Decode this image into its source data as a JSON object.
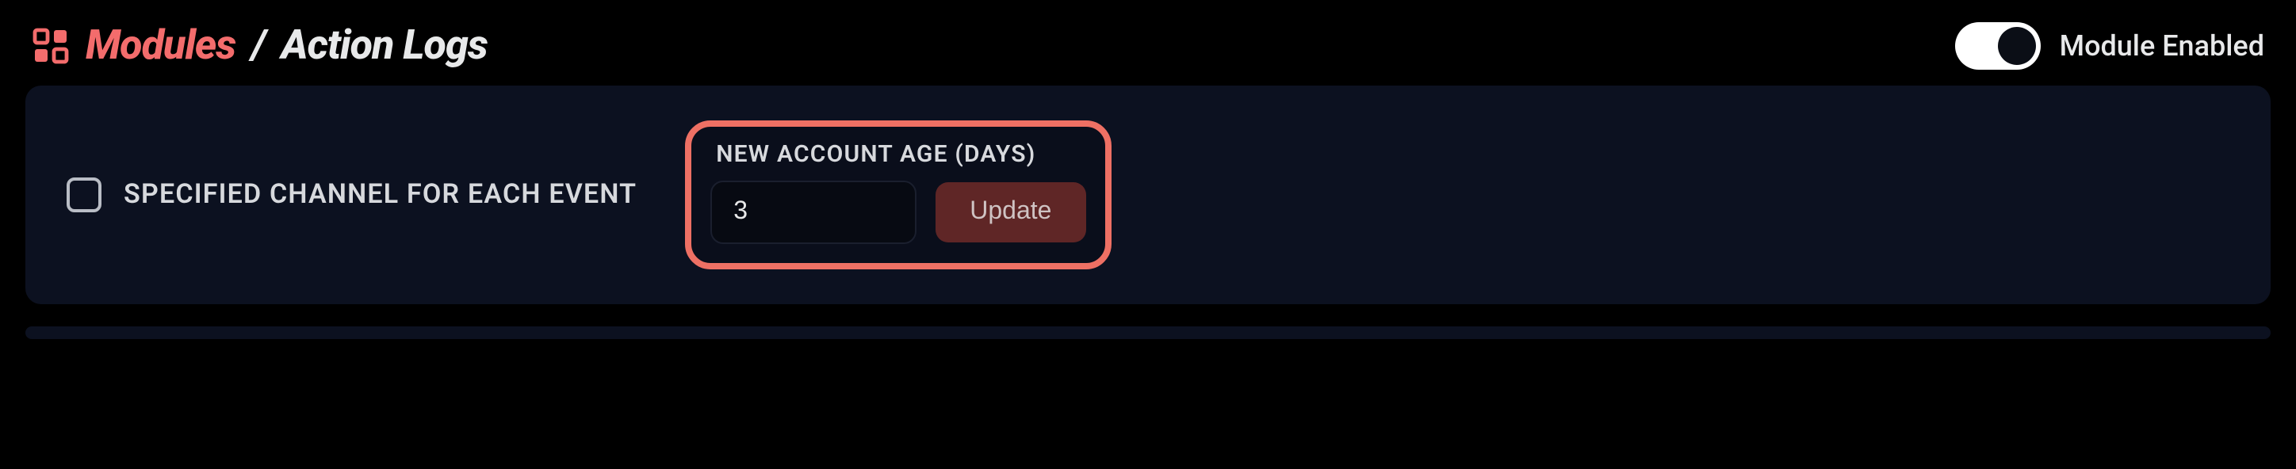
{
  "breadcrumb": {
    "root": "Modules",
    "separator": "/",
    "current": "Action Logs"
  },
  "toggle": {
    "label": "Module Enabled",
    "enabled": true
  },
  "settings": {
    "specified_channel_label": "SPECIFIED CHANNEL FOR EACH EVENT",
    "specified_channel_checked": false,
    "account_age": {
      "label": "NEW ACCOUNT AGE (DAYS)",
      "value": "3",
      "update_label": "Update"
    }
  },
  "colors": {
    "accent": "#f36c6c",
    "card": "#0c1120",
    "highlight_border": "#ee7064"
  }
}
